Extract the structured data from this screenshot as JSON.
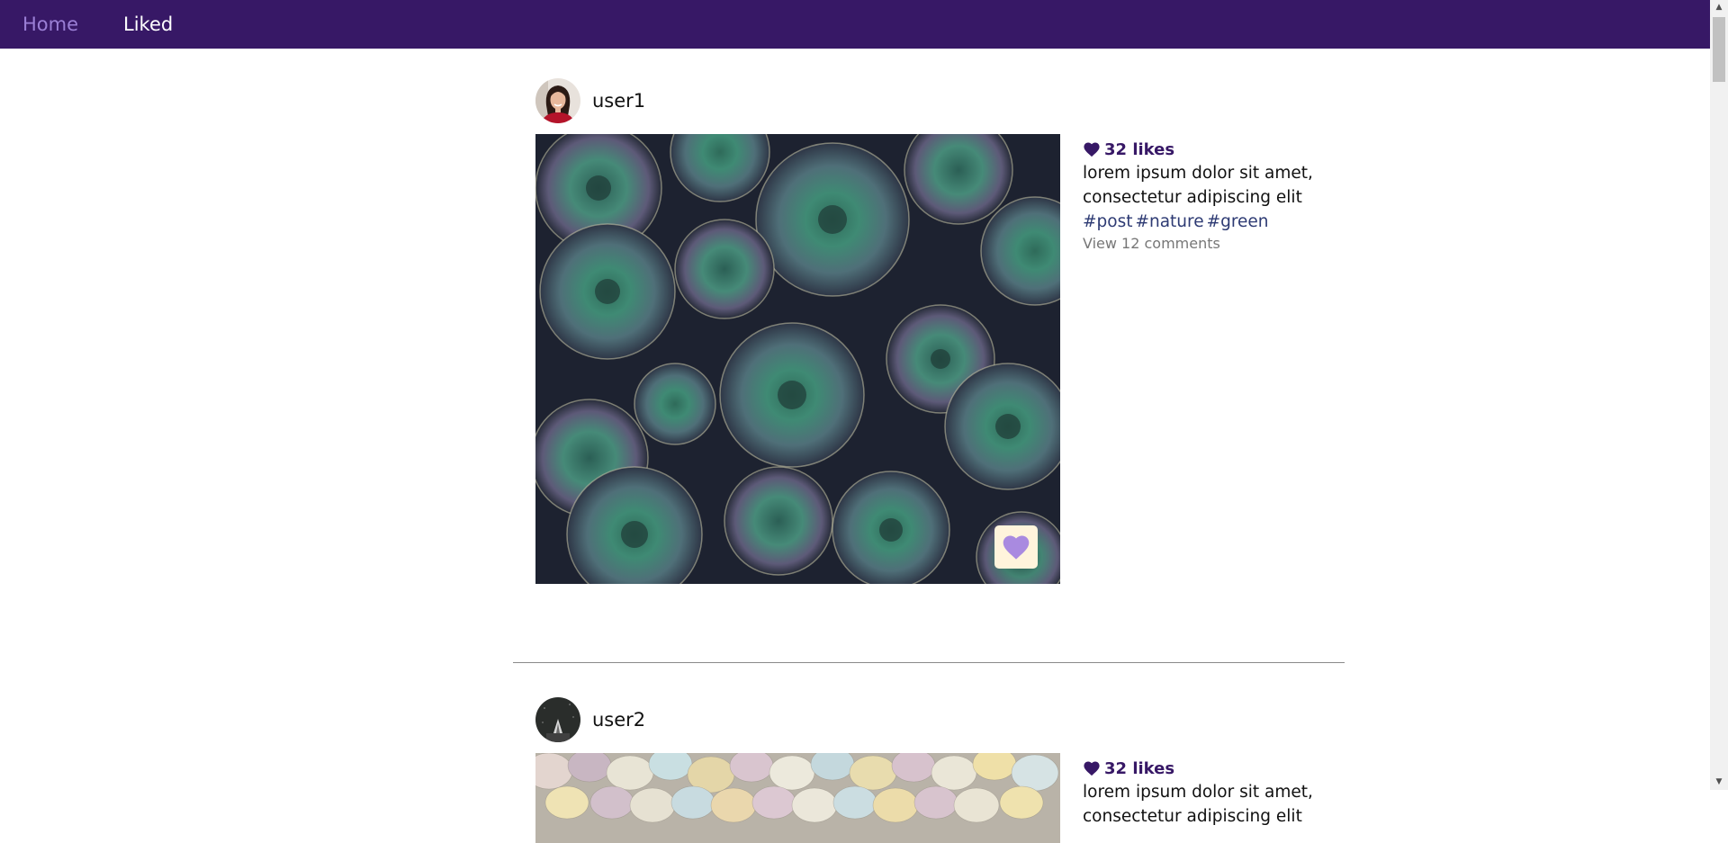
{
  "nav": {
    "home_label": "Home",
    "liked_label": "Liked"
  },
  "colors": {
    "navbar": "#371866",
    "accent": "#371866",
    "home_link": "#9b7fd6",
    "tags": "#2d3a73",
    "like_button_bg": "#fff4dc",
    "like_button_heart": "#a98ae0"
  },
  "posts": [
    {
      "username": "user1",
      "avatar_icon": "avatar-woman-red-shirt",
      "image": "succulents-photo",
      "likes": "32 likes",
      "caption": "lorem ipsum dolor sit amet, consectetur adipiscing elit",
      "tags": [
        "#post",
        "#nature",
        "#green"
      ],
      "comments": "View 12 comments",
      "liked": true
    },
    {
      "username": "user2",
      "avatar_icon": "avatar-dark-rocket",
      "image": "pastel-eggs-photo",
      "likes": "32 likes",
      "caption": "lorem ipsum dolor sit amet, consectetur adipiscing elit"
    }
  ]
}
